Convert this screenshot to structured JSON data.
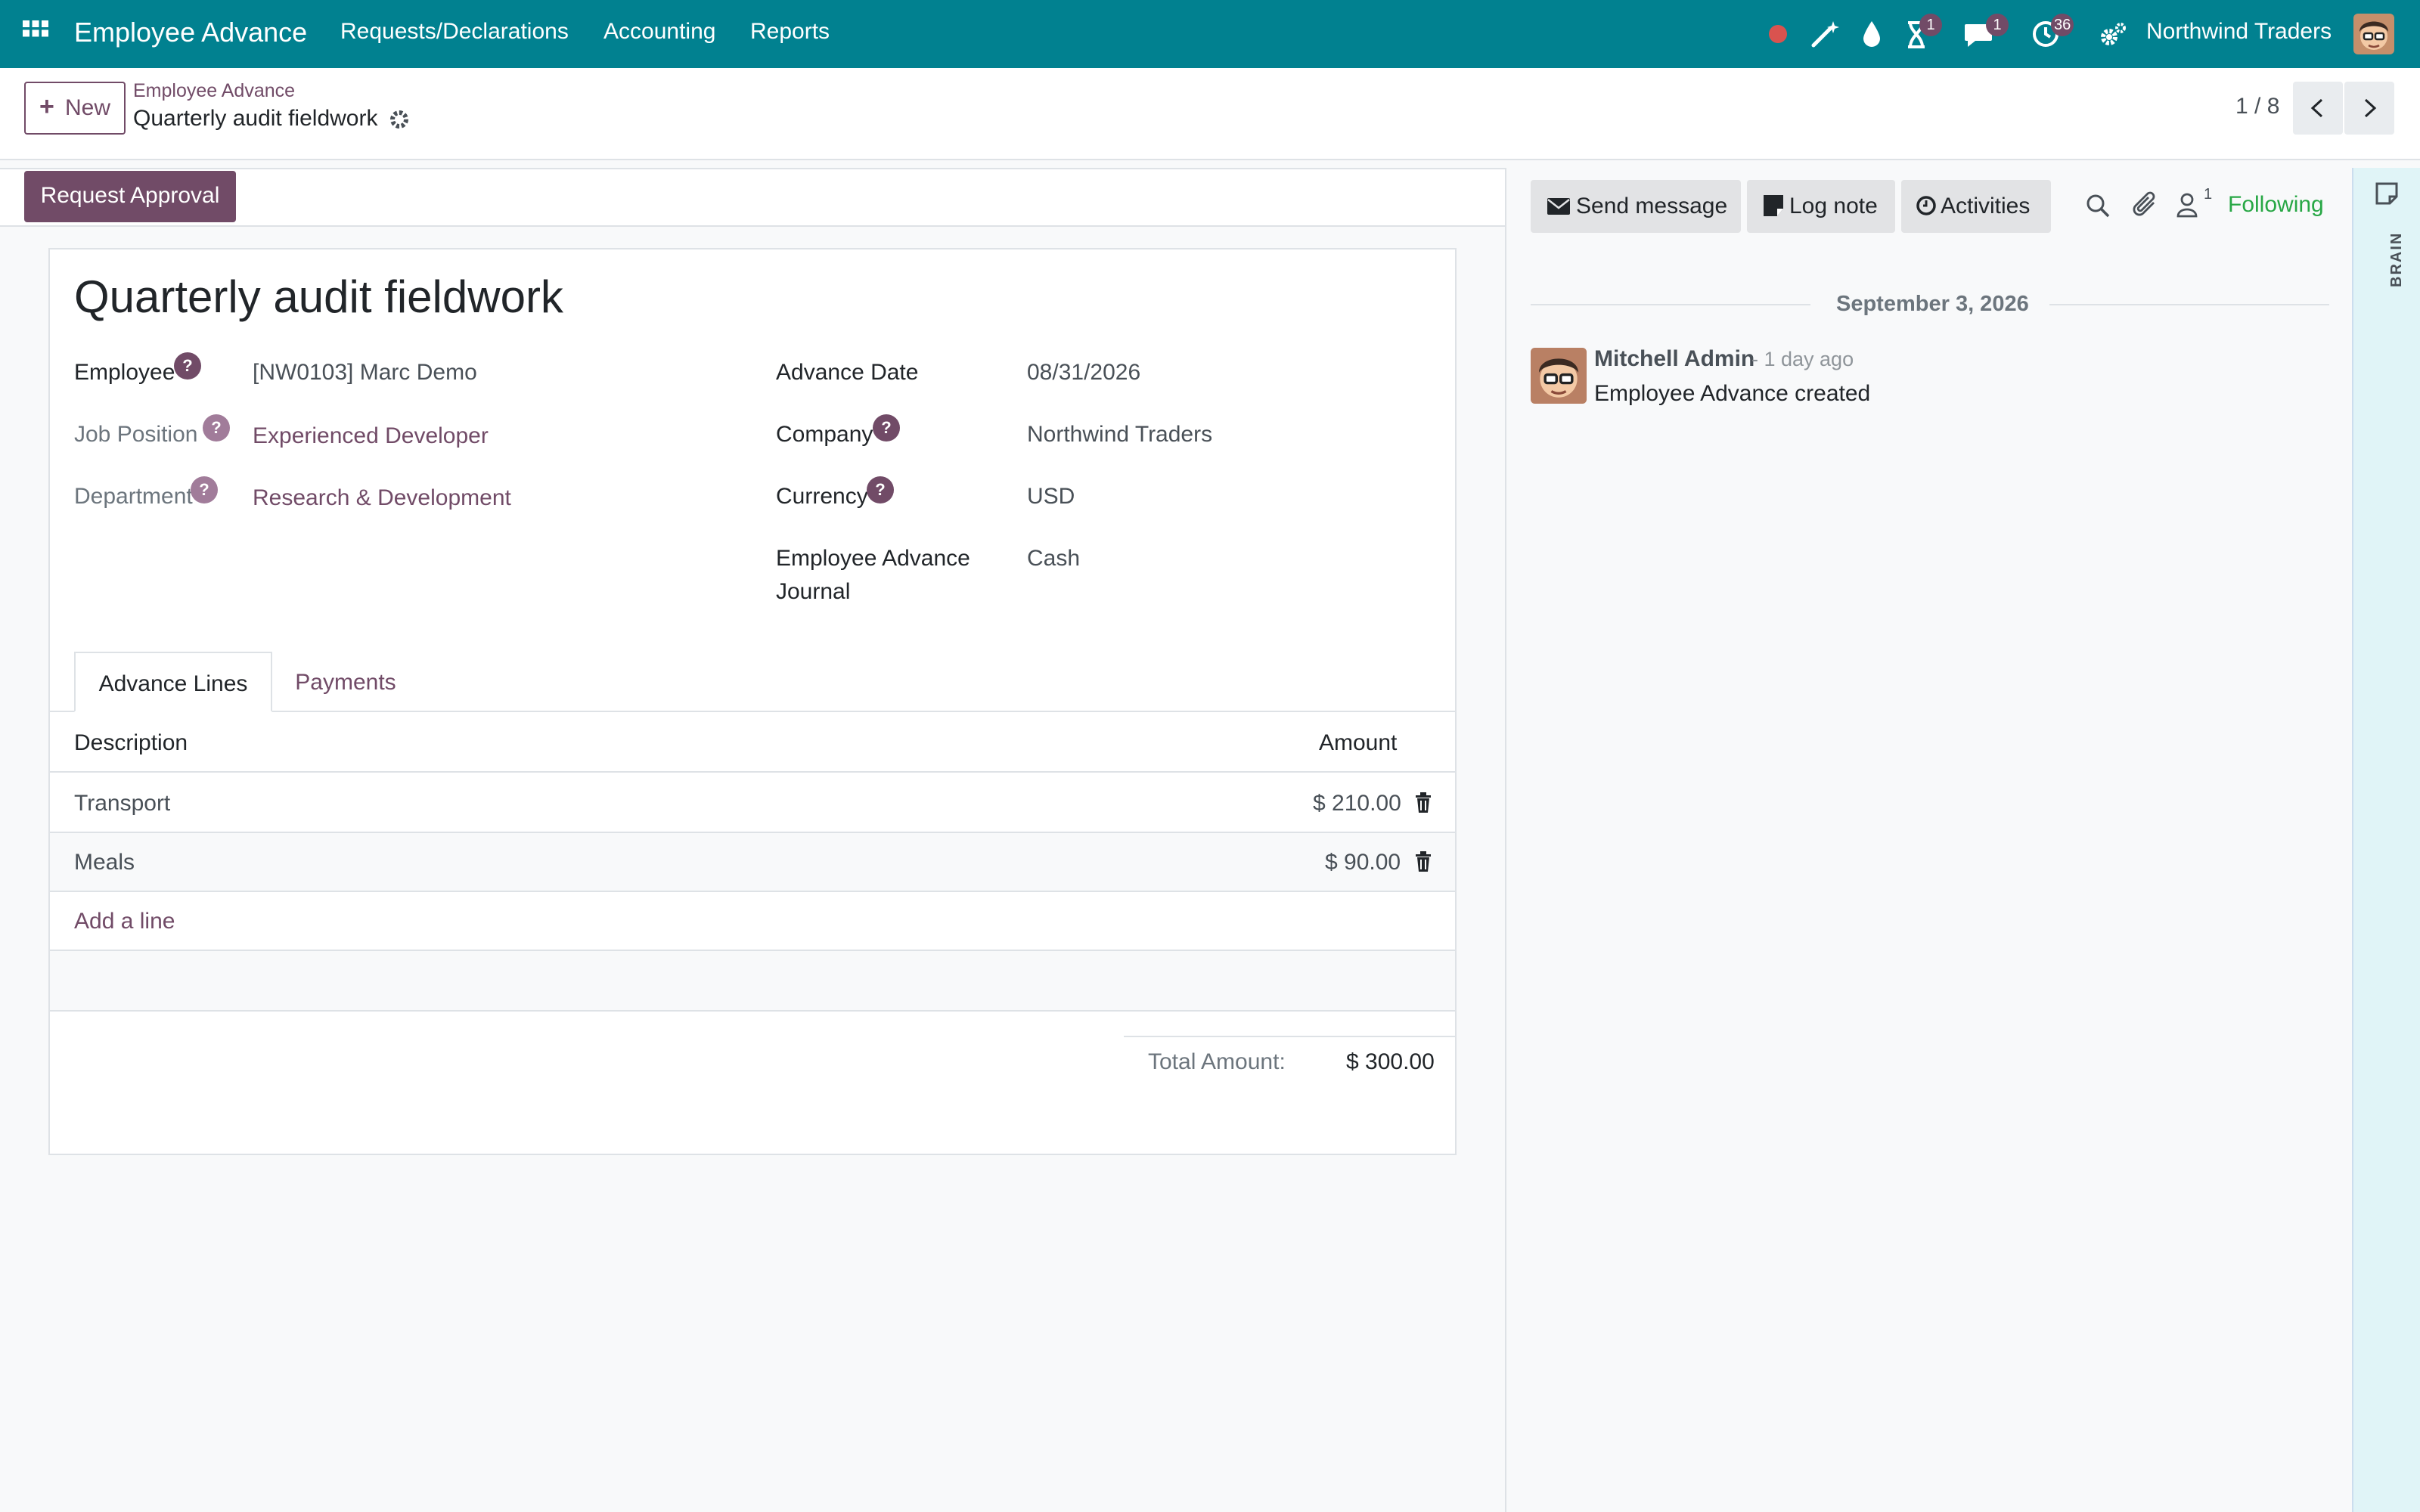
{
  "topbar": {
    "app_name": "Employee Advance",
    "menu": [
      "Requests/Declarations",
      "Accounting",
      "Reports"
    ],
    "badges": {
      "activity": "1",
      "messages": "1",
      "clock": "36"
    },
    "company": "Northwind Traders"
  },
  "control": {
    "new_label": "New",
    "breadcrumb_parent": "Employee Advance",
    "breadcrumb_current": "Quarterly audit fieldwork",
    "pager": "1 / 8"
  },
  "form": {
    "approve_label": "Request Approval",
    "title": "Quarterly audit fieldwork",
    "left_fields": [
      {
        "label": "Employee",
        "value": "[NW0103] Marc Demo"
      },
      {
        "label": "Job Position",
        "value": "Experienced Developer"
      },
      {
        "label": "Department",
        "value": "Research & Development"
      }
    ],
    "right_fields": [
      {
        "label": "Advance Date",
        "value": "08/31/2026"
      },
      {
        "label": "Company",
        "value": "Northwind Traders"
      },
      {
        "label": "Currency",
        "value": "USD"
      },
      {
        "label_line1": "Employee Advance",
        "label_line2": "Journal",
        "value": "Cash"
      }
    ],
    "help_mark": "?",
    "tabs": [
      "Advance Lines",
      "Payments"
    ],
    "table": {
      "headers": [
        "Description",
        "Amount"
      ],
      "rows": [
        {
          "description": "Transport",
          "amount": "$ 210.00"
        },
        {
          "description": "Meals",
          "amount": "$ 90.00"
        }
      ],
      "add_line": "Add a line"
    },
    "total_label": "Total Amount:",
    "total_value": "$ 300.00"
  },
  "chatter": {
    "send_message": "Send message",
    "log_note": "Log note",
    "activities": "Activities",
    "follower_count": "1",
    "following": "Following",
    "date_separator": "September 3, 2026",
    "message": {
      "author": "Mitchell Admin",
      "time": "- 1 day ago",
      "body": "Employee Advance created"
    }
  },
  "side_panel": {
    "label": "BRAIN"
  },
  "colors": {
    "navbar": "#018190",
    "primary": "#714b67",
    "following": "#28a745"
  }
}
